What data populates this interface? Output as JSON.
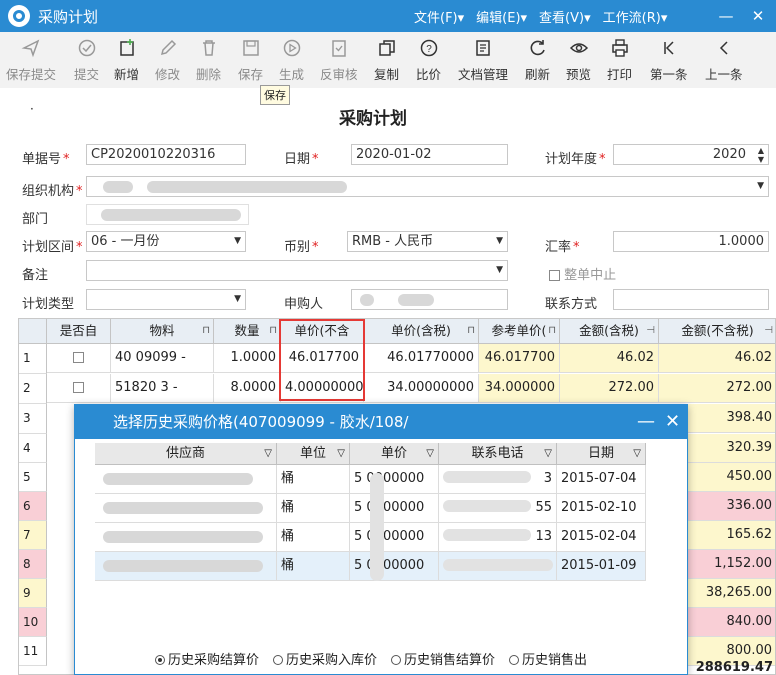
{
  "window": {
    "title": "采购计划",
    "min": "—",
    "close": "✕"
  },
  "menu": [
    {
      "label": "文件(F)",
      "arrow": "▾"
    },
    {
      "label": "编辑(E)",
      "arrow": "▾"
    },
    {
      "label": "查看(V)",
      "arrow": "▾"
    },
    {
      "label": "工作流(R)",
      "arrow": "▾"
    }
  ],
  "toolbar": {
    "save_submit": "保存提交",
    "submit": "提交",
    "add": "新增",
    "edit": "修改",
    "delete": "删除",
    "save": "保存",
    "generate": "生成",
    "unapprove": "反审核",
    "copy": "复制",
    "compare": "比价",
    "docs": "文档管理",
    "refresh": "刷新",
    "preview": "预览",
    "print": "打印",
    "first": "第一条",
    "prev": "上一条",
    "tooltip": "保存"
  },
  "form": {
    "title": "采购计划",
    "dot": "·",
    "doc_no_label": "单据号",
    "doc_no": "CP2020010220316",
    "date_label": "日期",
    "date": "2020-01-02",
    "year_label": "计划年度",
    "year": "2020",
    "org_label": "组织机构",
    "dept_label": "部门",
    "period_label": "计划区间",
    "period": "06 - 一月份",
    "currency_label": "币别",
    "currency": "RMB - 人民币",
    "rate_label": "汇率",
    "rate": "1.0000",
    "remark_label": "备注",
    "stop_label": "整单中止",
    "type_label": "计划类型",
    "buyer_label": "申购人",
    "contact_label": "联系方式",
    "required_mark": "*"
  },
  "grid": {
    "headers": [
      "是否自",
      "物料",
      "数量",
      "单价(不含",
      "单价(含税)",
      "参考单价(",
      "金额(含税)",
      "金额(不含税)"
    ],
    "rows": [
      {
        "n": "1",
        "material": "40 09099 -",
        "qty": "1.0000",
        "price_ex": "46.017700",
        "price_in": "46.01770000",
        "ref": "46.017700",
        "amt_in": "46.02",
        "amt_ex": "46.02"
      },
      {
        "n": "2",
        "material": "51820 3 -",
        "qty": "8.0000",
        "price_ex": "4.00000000",
        "price_in": "34.00000000",
        "ref": "34.000000",
        "amt_in": "272.00",
        "amt_ex": "272.00"
      },
      {
        "n": "3",
        "amt_ex": "398.40"
      },
      {
        "n": "4",
        "amt_ex": "320.39"
      },
      {
        "n": "5",
        "amt_ex": "450.00"
      },
      {
        "n": "6",
        "amt_ex": "336.00"
      },
      {
        "n": "7",
        "amt_ex": "165.62"
      },
      {
        "n": "8",
        "amt_ex": "1,152.00"
      },
      {
        "n": "9",
        "amt_ex": "38,265.00"
      },
      {
        "n": "10",
        "amt_ex": "840.00"
      },
      {
        "n": "11",
        "amt_ex": "800.00"
      }
    ],
    "total": "288619.47"
  },
  "dialog": {
    "title": "选择历史采购价格(407009099 - 胶水/108/",
    "min": "—",
    "close": "✕",
    "headers": [
      "供应商",
      "单位",
      "单价",
      "联系电话",
      "日期"
    ],
    "rows": [
      {
        "unit": "桶",
        "price": "5 0000000",
        "phone": "3",
        "date": "2015-07-04"
      },
      {
        "unit": "桶",
        "price": "5 0000000",
        "phone": "55",
        "date": "2015-02-10"
      },
      {
        "unit": "桶",
        "price": "5 0000000",
        "phone": "0 13",
        "date": "2015-02-04"
      },
      {
        "unit": "桶",
        "price": "5 0000000",
        "phone": "",
        "date": "2015-01-09"
      }
    ],
    "radios": [
      "历史采购结算价",
      "历史采购入库价",
      "历史销售结算价",
      "历史销售出"
    ]
  }
}
